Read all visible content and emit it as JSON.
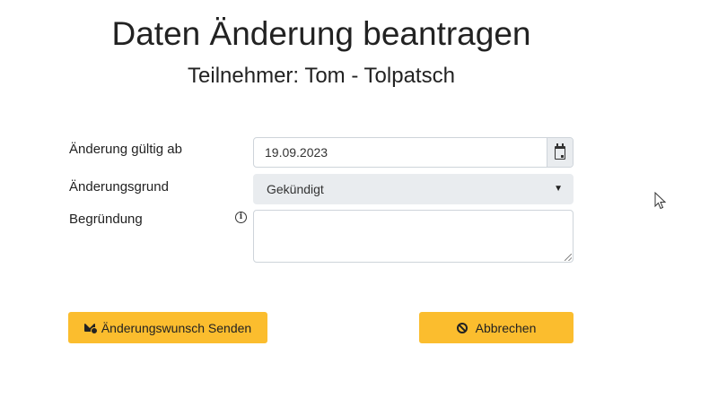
{
  "page": {
    "title": "Daten Änderung beantragen",
    "subtitle": "Teilnehmer: Tom - Tolpatsch"
  },
  "form": {
    "valid_from": {
      "label": "Änderung gültig ab",
      "value": "19.09.2023",
      "icon": "calendar-icon"
    },
    "reason": {
      "label": "Änderungsgrund",
      "selected": "Gekündigt",
      "icon": "chevron-down-icon"
    },
    "justification": {
      "label": "Begründung",
      "info_icon": "info-icon",
      "value": ""
    }
  },
  "actions": {
    "send_label": "Änderungswunsch Senden",
    "send_icon": "envelope-icon",
    "cancel_label": "Abbrechen",
    "cancel_icon": "ban-icon"
  },
  "colors": {
    "button_bg": "#fbbd2e",
    "select_bg": "#e9ecef",
    "input_border": "#ced4da"
  }
}
